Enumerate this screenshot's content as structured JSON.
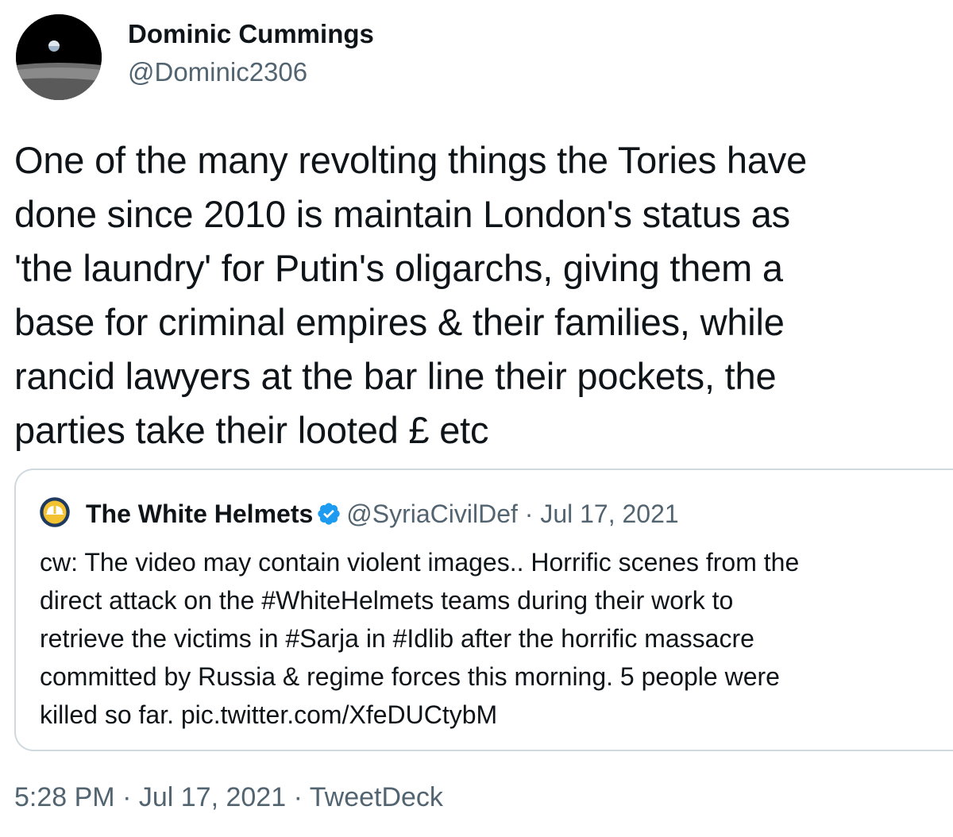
{
  "author": {
    "name": "Dominic Cummings",
    "handle": "@Dominic2306"
  },
  "tweet": {
    "lines": [
      "One of the many revolting things the Tories have",
      "done since 2010 is maintain London's status as",
      "'the laundry' for Putin's oligarchs, giving them a",
      "base for criminal empires & their families, while",
      "rancid lawyers at the bar line their pockets, the",
      "parties take their looted £ etc"
    ]
  },
  "quoted_tweet": {
    "name": "The White Helmets",
    "handle": "@SyriaCivilDef",
    "separator": "·",
    "date": "Jul 17, 2021",
    "lines": [
      "cw: The video may contain violent images.. Horrific scenes from the",
      "direct attack on the #WhiteHelmets teams during their work to",
      "retrieve the victims in #Sarja in #Idlib after the horrific massacre",
      "committed by Russia & regime forces this morning. 5 people were",
      "killed so far. pic.twitter.com/XfeDUCtybM"
    ]
  },
  "footer": {
    "time": "5:28 PM",
    "separator": "·",
    "date": "Jul 17, 2021",
    "source": "TweetDeck"
  },
  "colors": {
    "text": "#0f1419",
    "secondary": "#536471",
    "border": "#cfd9de",
    "verified": "#1d9bf0"
  },
  "icons": {
    "avatar": "earthrise-avatar",
    "quoted_avatar": "white-helmets-logo",
    "verified": "verified-badge-icon"
  }
}
